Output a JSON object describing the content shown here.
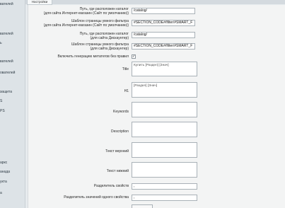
{
  "tab": {
    "label": "Настройки"
  },
  "sidebar": {
    "items": [
      "вателей",
      "вателей",
      "ь",
      "вателей",
      "ь",
      "ователей",
      "защита",
      "S",
      "PS",
      "аркс",
      "анада",
      "укта",
      "а"
    ]
  },
  "form": {
    "fields": [
      {
        "label": "Путь, где расположен каталог\n(для сайта Интернет-магазин (Сайт по умолчанию))",
        "value": "/catalog/"
      },
      {
        "label": "Шаблон страницы умного фильтра\n(для сайта Интернет-магазин (Сайт по умолчанию))",
        "value": "#SECTION_CODE#/filter/#SMART_F"
      },
      {
        "label": "Путь, где расположен каталог\n(для сайта Дискаунтер)",
        "value": "/catalog/"
      },
      {
        "label": "Шаблон страницы умного фильтра\n(для сайта Дискаунтер)",
        "value": "#SECTION_CODE#/filter/#SMART_F"
      }
    ],
    "no_rules": {
      "label": "Включить генерацию метатегов без правил",
      "checked": true,
      "check_glyph": "✓"
    },
    "textareas": [
      {
        "label": "Title",
        "value": "Купить [Раздел] [Знач]"
      },
      {
        "label": "H1",
        "value": "[Раздел] [Знач]"
      },
      {
        "label": "Keywords",
        "value": ""
      },
      {
        "label": "Description",
        "value": ""
      },
      {
        "label": "Текст верхний",
        "value": ""
      },
      {
        "label": "Текст нижний",
        "value": ""
      }
    ],
    "separators": [
      {
        "label": "Разделитель свойств",
        "value": ","
      },
      {
        "label": "Разделитель значений одного свойства",
        "value": ","
      }
    ]
  }
}
